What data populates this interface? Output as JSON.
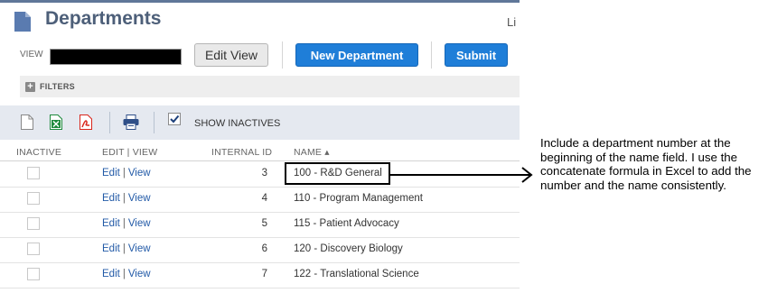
{
  "page": {
    "title": "Departments",
    "list_link": "Li"
  },
  "view": {
    "label": "VIEW",
    "edit_view_label": "Edit View"
  },
  "buttons": {
    "new_department": "New Department",
    "submit": "Submit"
  },
  "filters": {
    "label": "FILTERS"
  },
  "toolbar": {
    "icons": [
      "document-icon",
      "excel-icon",
      "pdf-icon",
      "print-icon"
    ],
    "show_inactives_label": "SHOW INACTIVES",
    "show_inactives_checked": true
  },
  "columns": {
    "inactive": "INACTIVE",
    "edit_view": "EDIT | VIEW",
    "internal_id": "INTERNAL ID",
    "name": "NAME ▴"
  },
  "rows": [
    {
      "edit": "Edit",
      "view": "View",
      "internal_id": "3",
      "name": "100 - R&D General"
    },
    {
      "edit": "Edit",
      "view": "View",
      "internal_id": "4",
      "name": "110 - Program Management"
    },
    {
      "edit": "Edit",
      "view": "View",
      "internal_id": "5",
      "name": "115 - Patient Advocacy"
    },
    {
      "edit": "Edit",
      "view": "View",
      "internal_id": "6",
      "name": "120 - Discovery Biology"
    },
    {
      "edit": "Edit",
      "view": "View",
      "internal_id": "7",
      "name": "122 - Translational Science"
    }
  ],
  "annotation": {
    "text": "Include a department number at the beginning of the name field. I use the concatenate formula in Excel to add the number and the name consistently."
  },
  "colors": {
    "accent_blue": "#1f7ed8",
    "title": "#4d5f79",
    "link": "#225aa7",
    "toolbar_bg": "#e5e9f0"
  }
}
